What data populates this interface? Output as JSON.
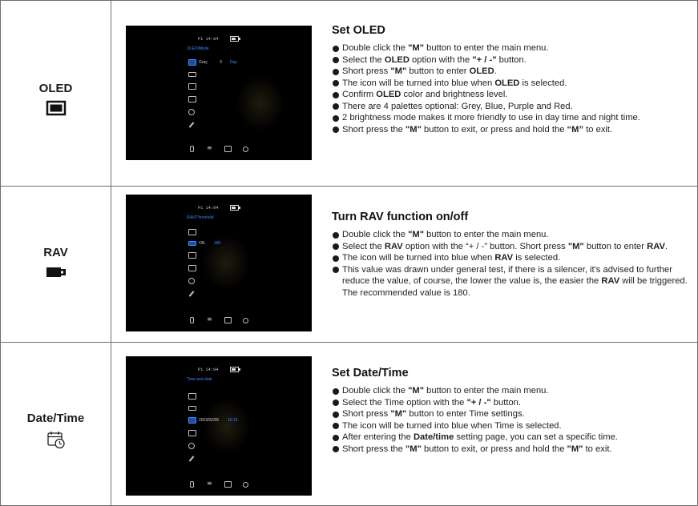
{
  "rows": [
    {
      "label": "OLED",
      "label_icon": "display-rect-icon",
      "screenshot": {
        "status": "P1  14:04",
        "menu_title": "OLED/Mode",
        "values": [
          "Gray",
          "3",
          "Day"
        ]
      },
      "heading": "Set OLED",
      "bullets": [
        [
          "Double click the ",
          {
            "b": "\"M\""
          },
          " button to enter the main menu."
        ],
        [
          "Select the ",
          {
            "b": "OLED"
          },
          " option with the ",
          {
            "b": " \"+ / -\""
          },
          " button."
        ],
        [
          "Short press ",
          {
            "b": "\"M\""
          },
          " button to enter ",
          {
            "b": "OLED"
          },
          "."
        ],
        [
          "The icon will be turned into blue when ",
          {
            "b": "OLED"
          },
          " is selected."
        ],
        [
          "Confirm ",
          {
            "b": "OLED"
          },
          " color and brightness level."
        ],
        [
          "There are 4 palettes optional: Grey, Blue, Purple and Red."
        ],
        [
          "2 brightness mode makes it more friendly to use in day time and night time."
        ],
        [
          "Short press the ",
          {
            "b": "\"M\""
          },
          " button to exit, or press and hold the ",
          {
            "b": "“M”"
          },
          " to exit."
        ]
      ]
    },
    {
      "label": "RAV",
      "label_icon": "rav-silencer-icon",
      "screenshot": {
        "status": "P1  14:04",
        "menu_title": "RAV/Threshold",
        "values": [
          "ON",
          "180"
        ]
      },
      "heading": "Turn RAV function on/off",
      "bullets": [
        [
          "Double click the ",
          {
            "b": "\"M\""
          },
          " button to enter the main menu."
        ],
        [
          "Select the ",
          {
            "b": "RAV"
          },
          " option with the “+ / -” button. Short press ",
          {
            "b": "\"M\""
          },
          " button to enter ",
          {
            "b": "RAV"
          },
          "."
        ],
        [
          "The icon will be turned into blue when ",
          {
            "b": "RAV"
          },
          " is selected."
        ],
        [
          "This value was drawn under general test, if there is a silencer, it's advised to further reduce the value, of course, the lower the value is, the easier the ",
          {
            "b": "RAV"
          },
          " will be triggered. The recommended value is 180."
        ]
      ]
    },
    {
      "label": "Date/Time",
      "label_icon": "calendar-clock-icon",
      "screenshot": {
        "status": "P1  14:04",
        "menu_title": "Time and date",
        "values": [
          "2023/02/06",
          "10:15"
        ]
      },
      "heading": "Set Date/Time",
      "bullets": [
        [
          "Double click the ",
          {
            "b": "\"M\""
          },
          " button to enter the main menu."
        ],
        [
          "Select the Time option with the ",
          {
            "b": "\"+ / -\""
          },
          " button."
        ],
        [
          "Short press ",
          {
            "b": "\"M\""
          },
          " button to enter Time settings."
        ],
        [
          "The icon will be turned into blue when Time is selected."
        ],
        [
          "After entering the ",
          {
            "b": "Date/time"
          },
          " setting page, you can set a specific time."
        ],
        [
          "Short press the ",
          {
            "b": "\"M\""
          },
          " button to exit, or press and hold the ",
          {
            "b": "\"M\""
          },
          " to exit."
        ]
      ]
    }
  ],
  "colors": {
    "accent": "#3d8cff",
    "border": "#6e6e6e"
  }
}
